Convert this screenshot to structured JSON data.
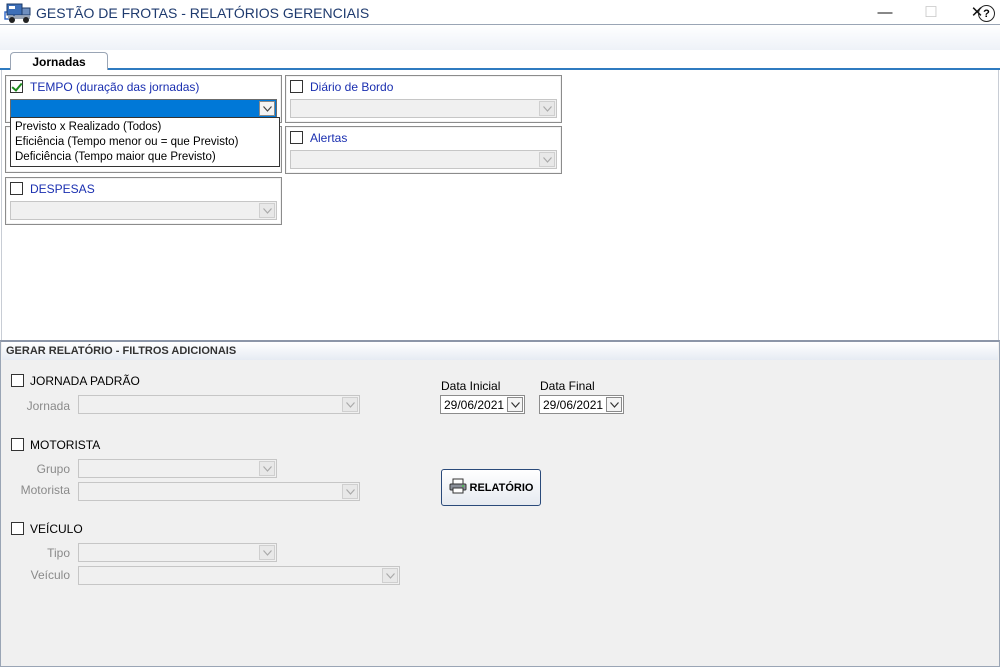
{
  "window": {
    "minimize_glyph": "—",
    "maximize_glyph": "☐",
    "close_glyph": "✕"
  },
  "header": {
    "title": "GESTÃO DE FROTAS - RELATÓRIOS GERENCIAIS",
    "help_glyph": "?"
  },
  "tabs": [
    {
      "label": "Jornadas",
      "active": true
    }
  ],
  "groups": {
    "tempo": {
      "label": "TEMPO (duração das jornadas)",
      "checked": true
    },
    "diario": {
      "label": "Diário de Bordo",
      "checked": false
    },
    "alertas": {
      "label": "Alertas",
      "checked": false
    },
    "despesas": {
      "label": "DESPESAS",
      "checked": false
    }
  },
  "tempo_dropdown": {
    "options": [
      "Previsto x Realizado (Todos)",
      "Eficiência (Tempo menor ou = que Previsto)",
      "Deficiência (Tempo maior que Previsto)"
    ]
  },
  "filters": {
    "section_title": "GERAR RELATÓRIO - FILTROS ADICIONAIS",
    "jornada_padrao": {
      "label": "JORNADA PADRÃO",
      "checked": false,
      "field_jornada": "Jornada"
    },
    "motorista": {
      "label": "MOTORISTA",
      "checked": false,
      "field_grupo": "Grupo",
      "field_motorista": "Motorista"
    },
    "veiculo": {
      "label": "VEÍCULO",
      "checked": false,
      "field_tipo": "Tipo",
      "field_veiculo": "Veículo"
    },
    "data_inicial": {
      "label": "Data Inicial",
      "value": "29/06/2021"
    },
    "data_final": {
      "label": "Data Final",
      "value": "29/06/2021"
    },
    "report_button": "RELATÓRIO"
  },
  "icons": {
    "app": "window-restore-icon",
    "header": "fleet-truck-icon",
    "help": "help-icon",
    "report": "printer-icon"
  },
  "colors": {
    "accent": "#0078d7",
    "group_label": "#1a2fb0",
    "header_title": "#1e3a6e",
    "tab_underline": "#2f7bc0",
    "check": "#1b8a1b"
  }
}
